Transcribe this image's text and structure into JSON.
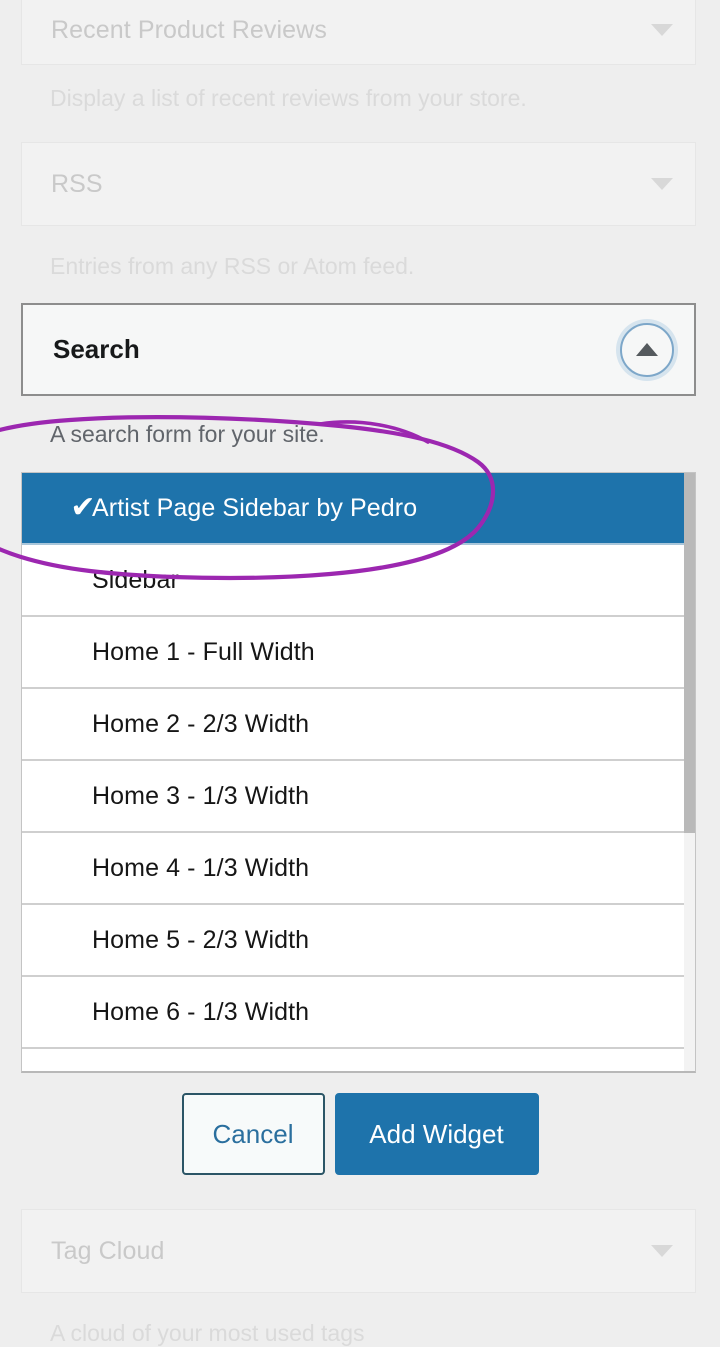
{
  "dimmed_widgets_above": [
    {
      "title": "Recent Product Reviews",
      "description": "Display a list of recent reviews from your store.",
      "caret": "chevron-down-icon"
    },
    {
      "title": "RSS",
      "description": "Entries from any RSS or Atom feed.",
      "caret": "chevron-down-icon"
    }
  ],
  "active_widget": {
    "title": "Search",
    "description": "A search form for your site.",
    "collapse_icon": "chevron-up-icon"
  },
  "sidebar_list": {
    "rows": [
      {
        "label": "Artist Page Sidebar by Pedro",
        "selected": true,
        "check": "✔"
      },
      {
        "label": "Sidebar",
        "selected": false,
        "check": ""
      },
      {
        "label": "Home 1 - Full Width",
        "selected": false,
        "check": ""
      },
      {
        "label": "Home 2 - 2/3 Width",
        "selected": false,
        "check": ""
      },
      {
        "label": "Home 3 - 1/3 Width",
        "selected": false,
        "check": ""
      },
      {
        "label": "Home 4 - 1/3 Width",
        "selected": false,
        "check": ""
      },
      {
        "label": "Home 5 - 2/3 Width",
        "selected": false,
        "check": ""
      },
      {
        "label": "Home 6 - 1/3 Width",
        "selected": false,
        "check": ""
      }
    ],
    "scrollbar": {
      "visible": true
    }
  },
  "actions": {
    "cancel_label": "Cancel",
    "add_widget_label": "Add Widget"
  },
  "dimmed_widgets_below": [
    {
      "title": "Tag Cloud",
      "description": "A cloud of your most used tags",
      "caret": "chevron-down-icon"
    }
  ],
  "annotation": {
    "type": "freehand-ellipse",
    "color": "#9c27b0",
    "target": "Artist Page Sidebar by Pedro"
  },
  "colors": {
    "page_background": "#eeeeee",
    "selected_row": "#1e73ab",
    "primary_button": "#1e73ab",
    "annotation_purple": "#9c27b0",
    "focus_ring": "#7da7c9"
  }
}
